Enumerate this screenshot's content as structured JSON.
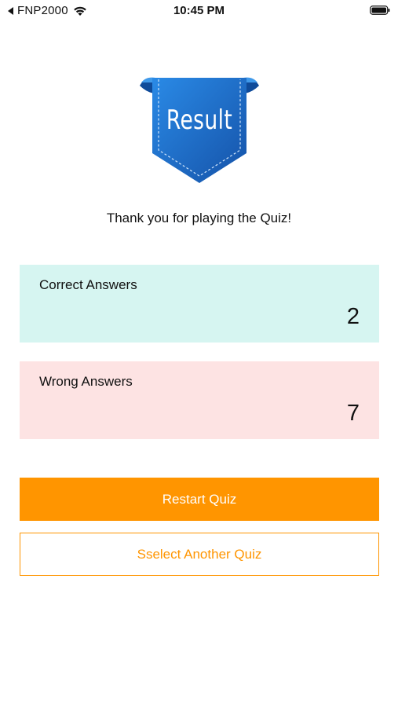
{
  "status_bar": {
    "carrier": "FNP2000",
    "time": "10:45 PM"
  },
  "badge": {
    "text": "Result",
    "colors": {
      "ribbon": "#1f6fd0",
      "ribbon_dark": "#1552a8",
      "fold": "#2d86e0"
    }
  },
  "message": "Thank you for playing the Quiz!",
  "scores": {
    "correct": {
      "label": "Correct Answers",
      "value": "2",
      "color": "#d6f5f1"
    },
    "wrong": {
      "label": "Wrong Answers",
      "value": "7",
      "color": "#fde3e3"
    }
  },
  "buttons": {
    "restart_label": "Restart Quiz",
    "another_label": "Sselect Another Quiz",
    "accent": "#ff9500"
  },
  "icons": [
    "back-arrow-icon",
    "wifi-icon",
    "battery-icon",
    "result-ribbon-icon"
  ]
}
